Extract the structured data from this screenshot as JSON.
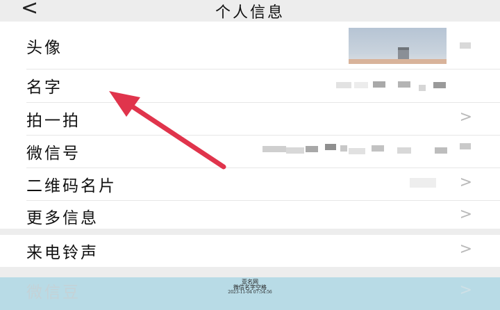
{
  "header": {
    "back_icon": "<",
    "title": "个人信息"
  },
  "groups": [
    {
      "items": [
        {
          "key": "avatar",
          "label": "头像"
        },
        {
          "key": "name",
          "label": "名字"
        },
        {
          "key": "pat",
          "label": "拍一拍",
          "chevron": ">"
        },
        {
          "key": "wechat_id",
          "label": "微信号"
        },
        {
          "key": "qr_card",
          "label": "二维码名片",
          "chevron": ">"
        },
        {
          "key": "more_info",
          "label": "更多信息",
          "chevron": ">"
        }
      ]
    },
    {
      "items": [
        {
          "key": "ringtone",
          "label": "来电铃声",
          "chevron": ">"
        }
      ]
    }
  ],
  "footer_item": {
    "label": "微信豆",
    "chevron": ">"
  },
  "watermark": {
    "line1": "亚名网",
    "line2": "微信名字空格",
    "line3": "2023-11-04 07:54:56"
  },
  "colors": {
    "accent_arrow": "#e0344c",
    "footer_bg": "#b8dbe6",
    "page_bg": "#ededed"
  },
  "icons": {
    "back": "chevron-left-icon",
    "row_chevron": "chevron-right-icon",
    "annotation": "red-arrow"
  }
}
